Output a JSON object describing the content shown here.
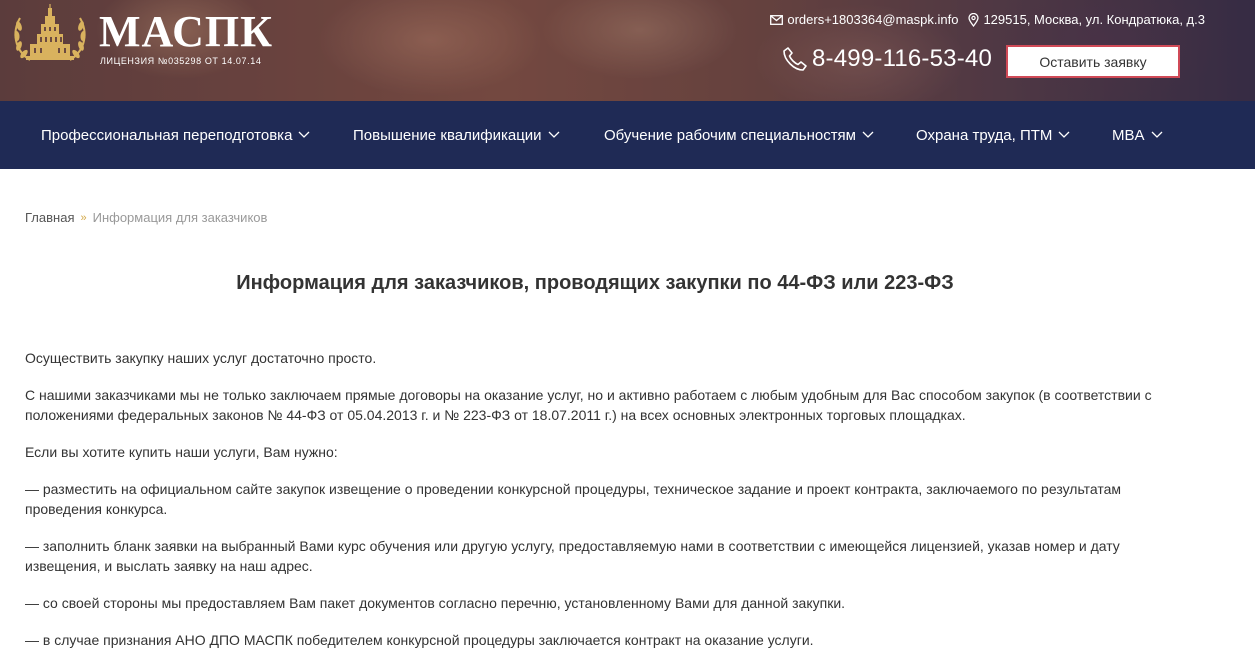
{
  "header": {
    "logo_title": "МАСПК",
    "logo_license": "ЛИЦЕНЗИЯ №035298 ОТ 14.07.14",
    "email": "orders+1803364@maspk.info",
    "address": "129515, Москва, ул. Кондратюка, д.3",
    "phone": "8-499-116-53-40",
    "request_button": "Оставить заявку",
    "icons": [
      "mail-icon",
      "location-pin-icon",
      "phone-icon",
      "logo-emblem"
    ]
  },
  "nav": {
    "items": [
      {
        "label": "Профессиональная переподготовка"
      },
      {
        "label": "Повышение квалификации"
      },
      {
        "label": "Обучение рабочим специальностям"
      },
      {
        "label": "Охрана труда, ПТМ"
      },
      {
        "label": "MBA"
      }
    ],
    "background": "#1f2a55"
  },
  "breadcrumb": {
    "home": "Главная",
    "separator": "»",
    "current": "Информация для заказчиков"
  },
  "main": {
    "title": "Информация для заказчиков, проводящих закупки по 44-ФЗ или 223-ФЗ",
    "paragraphs": [
      "Осуществить закупку наших услуг достаточно просто.",
      "С нашими заказчиками мы не только заключаем прямые договоры на оказание услуг, но и активно работаем с любым удобным для Вас способом закупок (в соответствии с положениями федеральных законов № 44-ФЗ от 05.04.2013 г. и № 223-ФЗ от 18.07.2011 г.) на всех основных электронных торговых площадках.",
      "Если вы хотите купить наши услуги, Вам нужно:",
      "— разместить на официальном сайте закупок извещение о проведении конкурсной процедуры, техническое задание и проект контракта, заключаемого по результатам проведения конкурса.",
      "— заполнить бланк заявки на выбранный Вами курс обучения или другую услугу, предоставляемую нами в соответствии с имеющейся лицензией, указав номер и дату извещения, и выслать заявку на наш адрес.",
      "— со своей стороны мы предоставляем Вам пакет документов согласно перечню, установленному Вами для данной закупки.",
      "— в случае признания АНО ДПО МАСПК победителем конкурсной процедуры заключается контракт на оказание услуги."
    ]
  },
  "colors": {
    "accent_gold": "#d4a94a",
    "button_border": "#d04a57",
    "nav_bg": "#1f2a55"
  }
}
